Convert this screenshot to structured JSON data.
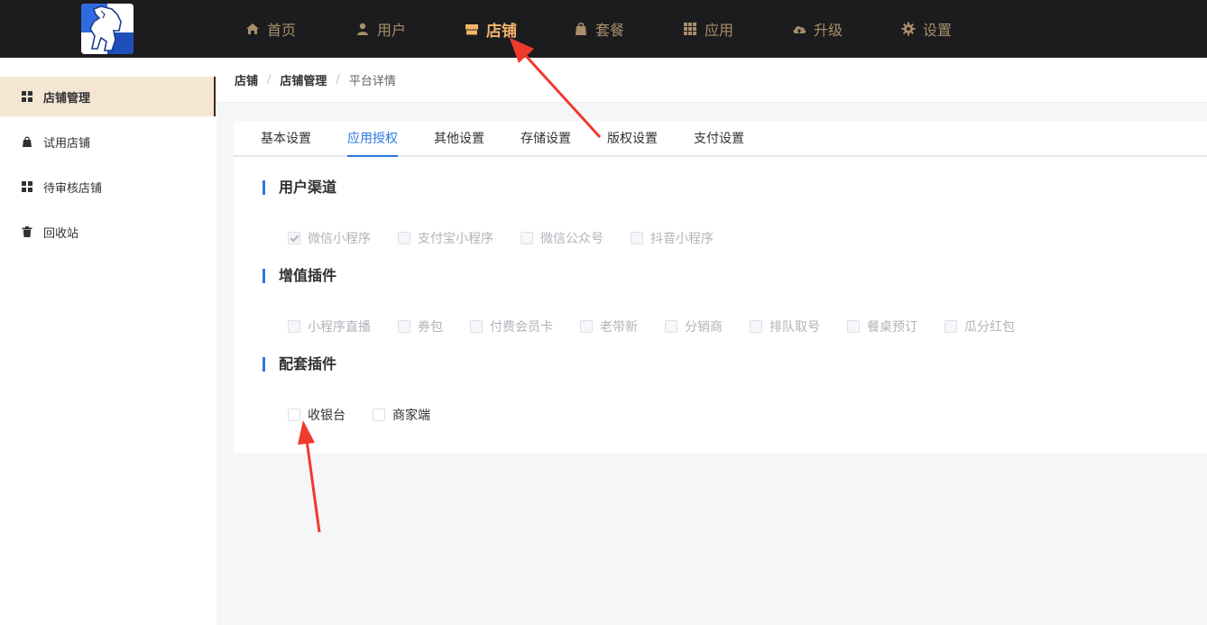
{
  "nav": {
    "items": [
      {
        "label": "首页",
        "icon": "home-icon"
      },
      {
        "label": "用户",
        "icon": "user-icon"
      },
      {
        "label": "店铺",
        "icon": "store-icon",
        "active": true
      },
      {
        "label": "套餐",
        "icon": "bag-icon"
      },
      {
        "label": "应用",
        "icon": "apps-icon"
      },
      {
        "label": "升级",
        "icon": "cloud-upload-icon"
      },
      {
        "label": "设置",
        "icon": "gear-icon"
      }
    ]
  },
  "sidebar": {
    "items": [
      {
        "label": "店铺管理",
        "icon": "grid-icon",
        "active": true
      },
      {
        "label": "试用店铺",
        "icon": "bag-icon"
      },
      {
        "label": "待审核店铺",
        "icon": "grid-icon"
      },
      {
        "label": "回收站",
        "icon": "trash-icon"
      }
    ]
  },
  "breadcrumb": {
    "items": [
      "店铺",
      "店铺管理",
      "平台详情"
    ],
    "separator": "/"
  },
  "tabs": {
    "items": [
      "基本设置",
      "应用授权",
      "其他设置",
      "存储设置",
      "版权设置",
      "支付设置"
    ],
    "active_index": 1
  },
  "sections": {
    "channels": {
      "title": "用户渠道",
      "options": [
        {
          "label": "微信小程序",
          "checked": true
        },
        {
          "label": "支付宝小程序",
          "checked": false
        },
        {
          "label": "微信公众号",
          "checked": false
        },
        {
          "label": "抖音小程序",
          "checked": false
        }
      ]
    },
    "addons": {
      "title": "增值插件",
      "options": [
        {
          "label": "小程序直播",
          "checked": false
        },
        {
          "label": "券包",
          "checked": false
        },
        {
          "label": "付费会员卡",
          "checked": false
        },
        {
          "label": "老带新",
          "checked": false
        },
        {
          "label": "分销商",
          "checked": false
        },
        {
          "label": "排队取号",
          "checked": false
        },
        {
          "label": "餐桌预订",
          "checked": false
        },
        {
          "label": "瓜分红包",
          "checked": false
        }
      ]
    },
    "bundled": {
      "title": "配套插件",
      "options": [
        {
          "label": "收银台",
          "checked": false
        },
        {
          "label": "商家端",
          "checked": false
        }
      ]
    }
  },
  "colors": {
    "topbar_bg": "#1c1c1e",
    "nav_text": "#a88e6b",
    "nav_active": "#f3b36a",
    "accent_blue": "#2b77e0",
    "sidebar_active_bg": "#f5e6d3",
    "annotation_arrow": "#f03a2e"
  }
}
